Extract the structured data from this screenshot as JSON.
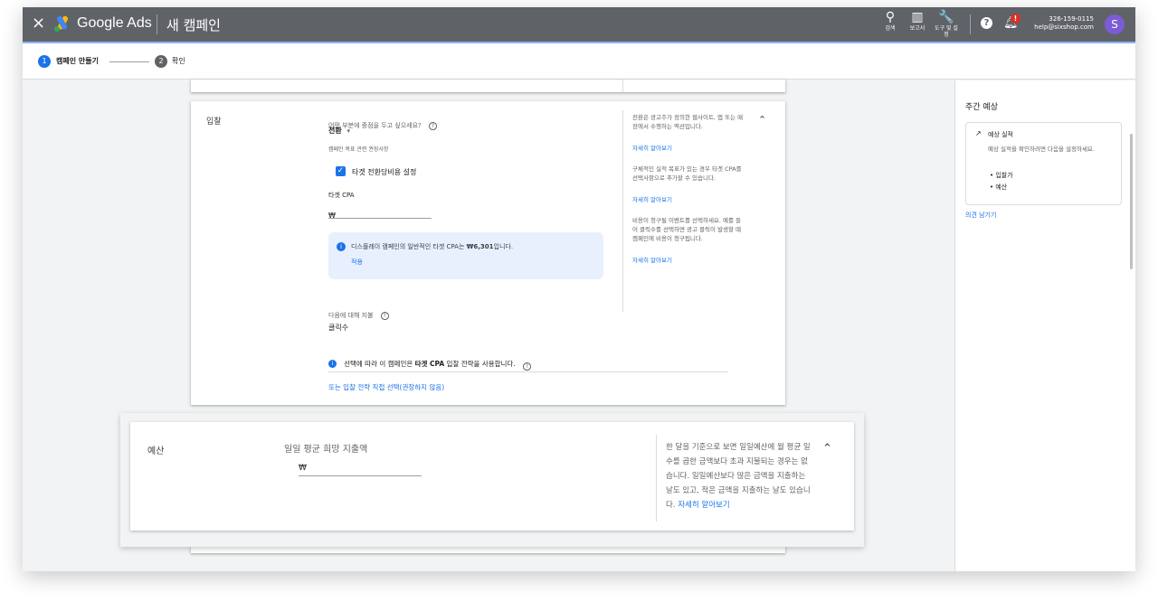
{
  "topbar": {
    "close": "×",
    "brand": "Google Ads",
    "page_title": "새 캠페인",
    "icons": [
      {
        "name": "search-icon",
        "glyph": "⚲",
        "label": "검색"
      },
      {
        "name": "reports-icon",
        "glyph": "▥",
        "label": "보고서"
      },
      {
        "name": "tools-icon",
        "glyph": "🔧",
        "label": "도구 및 설정"
      }
    ],
    "help": "?",
    "notification_badge": "!",
    "account_id": "326-159-0115",
    "account_email": "help@sixshop.com",
    "avatar_letter": "S"
  },
  "stepper": {
    "steps": [
      {
        "num": "1",
        "label": "캠페인 만들기"
      },
      {
        "num": "2",
        "label": "확인"
      }
    ]
  },
  "bidding": {
    "label": "입찰",
    "question": "어떤 부분에 중점을 두고 싶으세요?",
    "focus_value": "전환",
    "recommend": "캠페인 목표 관련 권장사항",
    "checkbox_label": "타겟 전환당비용 설정",
    "target_cpa_label": "타겟 CPA",
    "currency": "₩",
    "info_text_pre": "디스플레이 캠페인의 일반적인 타겟 CPA는 ",
    "info_amount": "₩6,301",
    "info_text_post": "입니다.",
    "apply": "적용",
    "pay_for_label": "다음에 대해 지불",
    "pay_for_value": "클릭수",
    "strategy_pre": "선택에 따라 이 캠페인은 ",
    "strategy_bold": "타겟 CPA",
    "strategy_post": " 입찰 전략을 사용합니다.",
    "manual_link": "또는 입찰 전략 직접 선택(권장하지 않음)",
    "help_1": "전환은 광고주가 정의한 웹사이트, 앱 또는 매장에서 수행하는 액션입니다.",
    "help_2": "구체적인 실적 목표가 있는 경우 타겟 CPA를 선택사항으로 추가할 수 있습니다.",
    "help_3": "비용이 청구될 이벤트를 선택하세요. 예를 들어 클릭수를 선택하면 광고 클릭이 발생할 때 캠페인에 비용이 청구됩니다.",
    "learn_more": "자세히 알아보기"
  },
  "budget": {
    "label": "예산",
    "field_label": "일일 평균 희망 지출액",
    "currency": "₩",
    "help_text": "한 달을 기준으로 보면 일일예산에 월 평균 일수를 곱한 금액보다 초과 지불되는 경우는 없습니다. 일일예산보다 많은 금액을 지출하는 날도 있고, 적은 금액을 지출하는 날도 있습니다.",
    "learn_more": "자세히 알아보기"
  },
  "weekly": {
    "title": "주간 예상",
    "metric_title": "예상 실적",
    "metric_desc": "예상 실적을 확인하려면 다음을 설정하세요.",
    "items": [
      "입찰가",
      "예산"
    ],
    "feedback": "의견 남기기"
  },
  "colors": {
    "primary": "#1a73e8",
    "topbar": "#5f6368",
    "info_bg": "#e8f0fe"
  }
}
